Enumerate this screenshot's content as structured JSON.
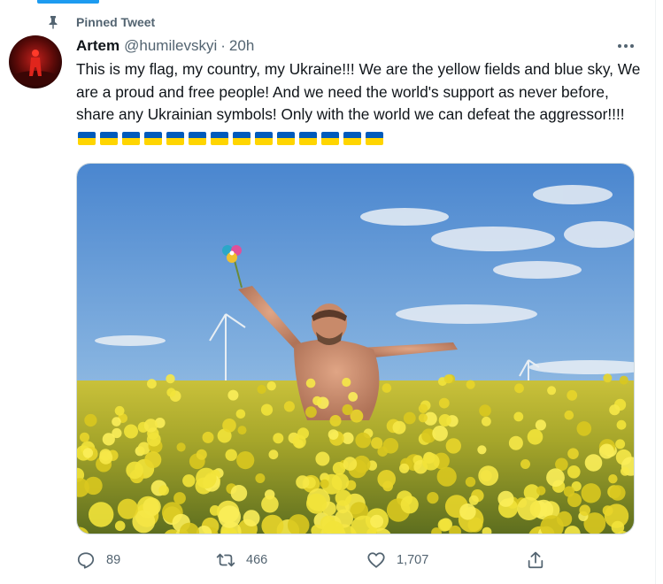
{
  "pinned": {
    "label": "Pinned Tweet",
    "icon": "pin-icon"
  },
  "tweet": {
    "author_name": "Artem",
    "handle": "@humilevskyi",
    "separator": "·",
    "time": "20h",
    "text": "This is my flag, my country, my Ukraine!!! We are the yellow fields and blue sky, We are a proud and free people! And we need the world's support as never before, share any Ukrainian symbols! Only with the world we can defeat the aggressor!!!!",
    "flag_emoji_count": 14,
    "flag_colors": {
      "blue": "#005bbb",
      "yellow": "#ffd500"
    }
  },
  "actions": {
    "reply": {
      "count": "89",
      "icon": "reply-icon"
    },
    "retweet": {
      "count": "466",
      "icon": "retweet-icon"
    },
    "like": {
      "count": "1,707",
      "icon": "heart-icon"
    },
    "share": {
      "icon": "share-icon"
    }
  },
  "colors": {
    "accent": "#1d9bf0",
    "secondary_text": "#536471",
    "primary_text": "#0f1419"
  }
}
